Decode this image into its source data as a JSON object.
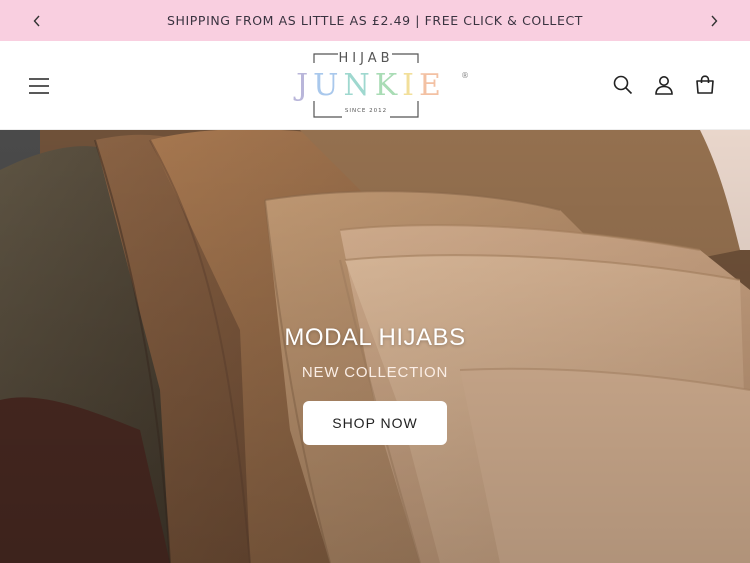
{
  "announcement": {
    "text": "SHIPPING FROM AS LITTLE AS £2.49 | FREE CLICK & COLLECT",
    "prev_icon": "chevron-left-icon",
    "next_icon": "chevron-right-icon",
    "background": "#f9cfe0"
  },
  "header": {
    "menu_icon": "hamburger-menu-icon",
    "icons": [
      "search-icon",
      "account-icon",
      "cart-icon"
    ]
  },
  "logo": {
    "top_text": "HIJAB",
    "main_letters": [
      {
        "char": "J",
        "color": "#b9b6da"
      },
      {
        "char": "U",
        "color": "#a9c8ec"
      },
      {
        "char": "N",
        "color": "#9fd8cf"
      },
      {
        "char": "K",
        "color": "#a9dcb5"
      },
      {
        "char": "I",
        "color": "#f2df9a"
      },
      {
        "char": "E",
        "color": "#f3c1a3"
      }
    ],
    "trademark": "®",
    "since": "SINCE 2012"
  },
  "hero": {
    "title": "MODAL HIJABS",
    "subtitle": "NEW COLLECTION",
    "button_label": "SHOP NOW"
  }
}
